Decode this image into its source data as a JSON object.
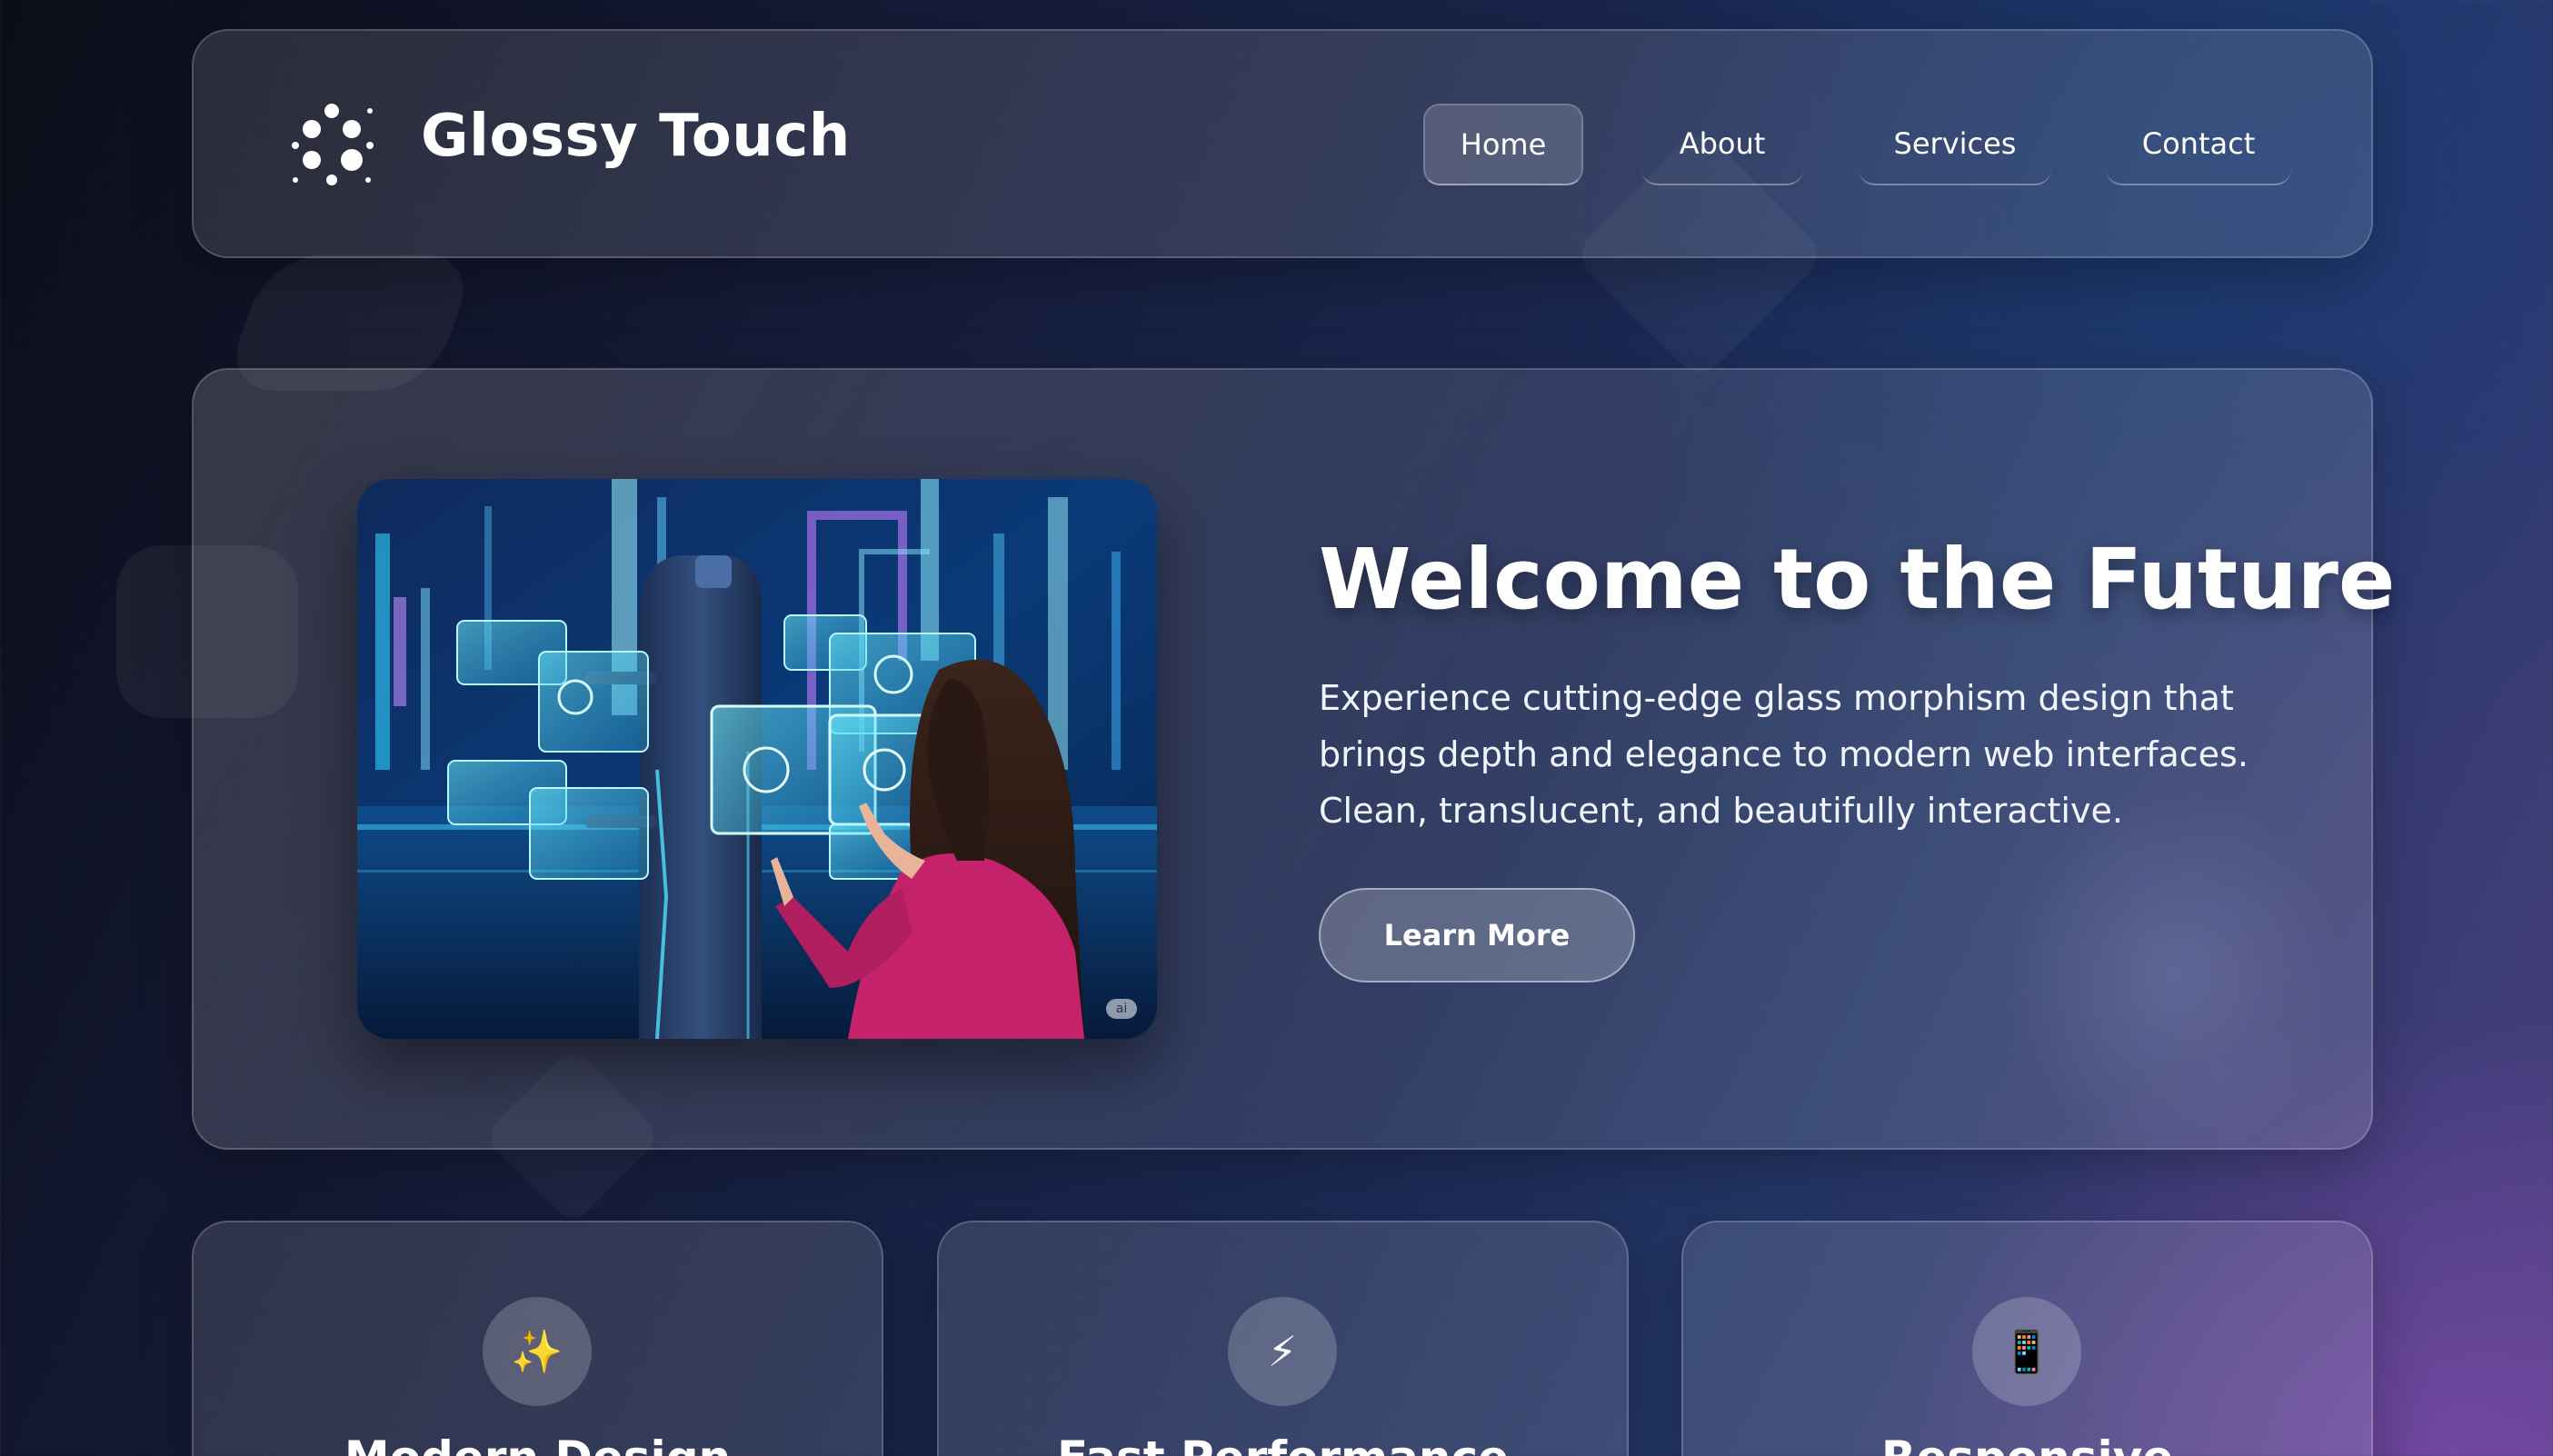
{
  "brand": {
    "name": "Glossy Touch",
    "logo_icon": "dots-circle-icon"
  },
  "nav": {
    "items": [
      {
        "label": "Home",
        "active": true
      },
      {
        "label": "About",
        "active": false
      },
      {
        "label": "Services",
        "active": false
      },
      {
        "label": "Contact",
        "active": false
      }
    ]
  },
  "hero": {
    "title": "Welcome to the Future",
    "description": "Experience cutting-edge glass morphism design that brings depth and elegance to modern web interfaces. Clean, translucent, and beautifully interactive.",
    "cta_label": "Learn More",
    "image_badge": "ai"
  },
  "features": [
    {
      "icon": "✨",
      "icon_name": "sparkles-icon",
      "title": "Modern Design"
    },
    {
      "icon": "⚡",
      "icon_name": "lightning-icon",
      "title": "Fast Performance"
    },
    {
      "icon": "📱",
      "icon_name": "mobile-phone-icon",
      "title": "Responsive"
    }
  ],
  "colors": {
    "background_start": "#0b0d17",
    "background_end": "#4a3f7f",
    "text": "#ffffff"
  }
}
